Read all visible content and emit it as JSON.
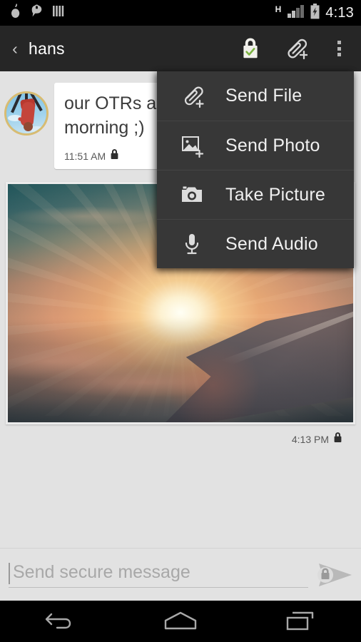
{
  "status_bar": {
    "time": "4:13",
    "network_type": "H",
    "left_icons": [
      "onion-icon",
      "lock-chat-bubble-icon",
      "bars-icon"
    ],
    "right_icons": [
      "signal-bars-icon",
      "battery-charging-icon"
    ]
  },
  "action_bar": {
    "back_label": "‹",
    "title": "hans",
    "icons": {
      "verified_lock": "lock-verified-icon",
      "attach": "paperclip-plus-icon",
      "overflow": "overflow-menu-icon"
    }
  },
  "attach_menu": {
    "visible": true,
    "items": [
      {
        "label": "Send File",
        "icon": "paperclip-plus-icon"
      },
      {
        "label": "Send Photo",
        "icon": "image-plus-icon"
      },
      {
        "label": "Take Picture",
        "icon": "camera-icon"
      },
      {
        "label": "Send Audio",
        "icon": "microphone-icon"
      }
    ]
  },
  "conversation": {
    "messages": [
      {
        "type": "text",
        "direction": "incoming",
        "line1": "our OTRs are",
        "line2": "morning ;)",
        "time": "11:51 AM",
        "encrypted_icon": "lock-icon",
        "avatar": "contact-avatar-person-on-swing"
      },
      {
        "type": "photo",
        "direction": "incoming",
        "description": "sunset-from-airplane-window-with-wing",
        "time": "4:13 PM",
        "encrypted_icon": "lock-icon"
      }
    ]
  },
  "composer": {
    "placeholder": "Send secure message",
    "value": "",
    "send_icon": "send-secure-arrow-lock-icon"
  },
  "nav_bar": {
    "buttons": [
      {
        "name": "back",
        "icon": "back-arrow-icon"
      },
      {
        "name": "home",
        "icon": "home-icon"
      },
      {
        "name": "recents",
        "icon": "recent-apps-icon"
      }
    ]
  },
  "colors": {
    "status_bar_bg": "#000000",
    "action_bar_bg": "#262626",
    "chat_bg": "#e2e2e2",
    "bubble_bg": "#ffffff",
    "menu_bg": "#373737",
    "accent_green": "#7cb342",
    "avatar_ring": "#d8bc72"
  }
}
